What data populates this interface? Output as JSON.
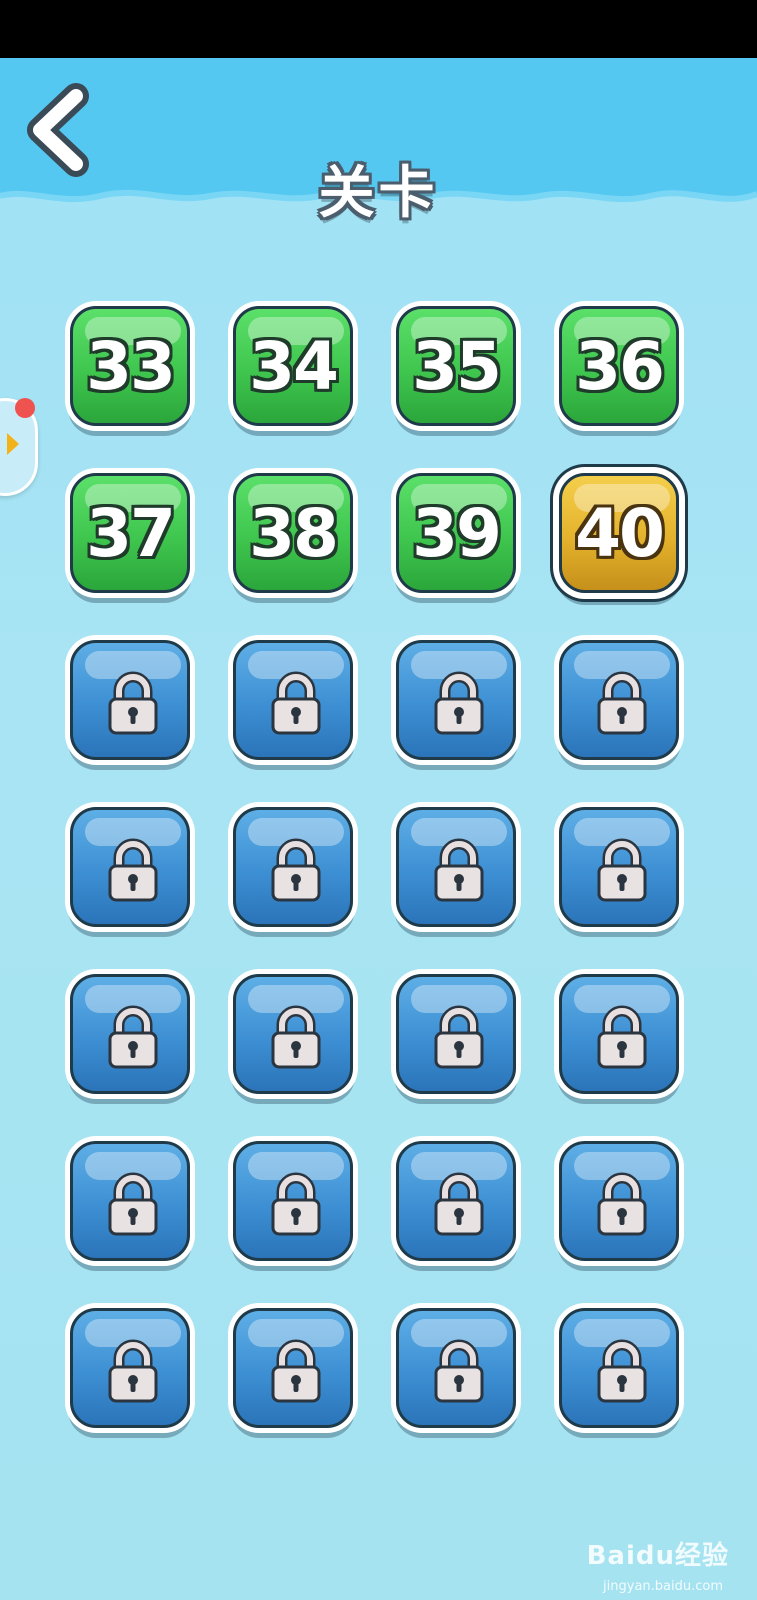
{
  "header": {
    "title": "关卡",
    "back_icon": "chevron-left-icon"
  },
  "side_panel": {
    "icon": "chevron-right-icon",
    "has_notification": true
  },
  "colors": {
    "completed": "#3fc64e",
    "current": "#e4b22c",
    "locked": "#3d8fd3",
    "notification": "#ef5350"
  },
  "levels": [
    {
      "label": "33",
      "state": "completed"
    },
    {
      "label": "34",
      "state": "completed"
    },
    {
      "label": "35",
      "state": "completed"
    },
    {
      "label": "36",
      "state": "completed"
    },
    {
      "label": "37",
      "state": "completed"
    },
    {
      "label": "38",
      "state": "completed"
    },
    {
      "label": "39",
      "state": "completed"
    },
    {
      "label": "40",
      "state": "current"
    },
    {
      "label": "",
      "state": "locked"
    },
    {
      "label": "",
      "state": "locked"
    },
    {
      "label": "",
      "state": "locked"
    },
    {
      "label": "",
      "state": "locked"
    },
    {
      "label": "",
      "state": "locked"
    },
    {
      "label": "",
      "state": "locked"
    },
    {
      "label": "",
      "state": "locked"
    },
    {
      "label": "",
      "state": "locked"
    },
    {
      "label": "",
      "state": "locked"
    },
    {
      "label": "",
      "state": "locked"
    },
    {
      "label": "",
      "state": "locked"
    },
    {
      "label": "",
      "state": "locked"
    },
    {
      "label": "",
      "state": "locked"
    },
    {
      "label": "",
      "state": "locked"
    },
    {
      "label": "",
      "state": "locked"
    },
    {
      "label": "",
      "state": "locked"
    },
    {
      "label": "",
      "state": "locked"
    },
    {
      "label": "",
      "state": "locked"
    },
    {
      "label": "",
      "state": "locked"
    },
    {
      "label": "",
      "state": "locked"
    }
  ],
  "watermark": {
    "brand": "Baidu经验",
    "url": "jingyan.baidu.com"
  }
}
